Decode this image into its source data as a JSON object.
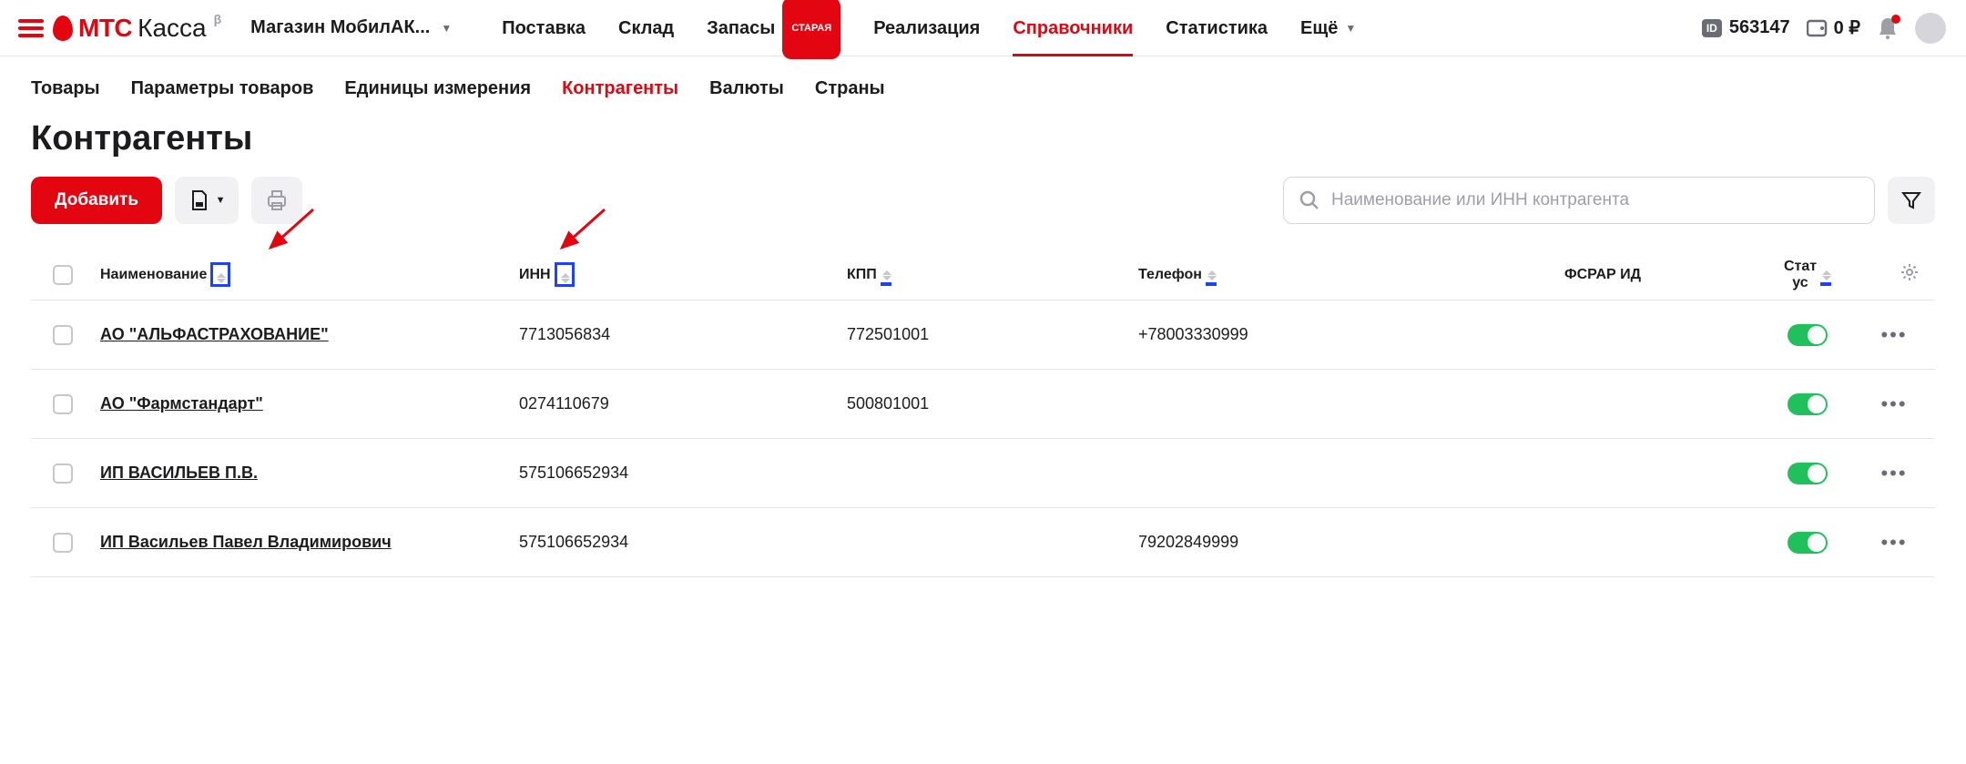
{
  "header": {
    "logo_mts": "МТС",
    "logo_kassa": "Касса",
    "beta": "β",
    "store_name": "Магазин МобилАК...",
    "nav": [
      "Поставка",
      "Склад",
      "Запасы",
      "Реализация",
      "Справочники",
      "Статистика",
      "Ещё"
    ],
    "badge_old": "СТАРАЯ",
    "active_nav": "Справочники",
    "id": "563147",
    "wallet": "0 ₽"
  },
  "sub_tabs": {
    "items": [
      "Товары",
      "Параметры товаров",
      "Единицы измерения",
      "Контрагенты",
      "Валюты",
      "Страны"
    ],
    "active": "Контрагенты"
  },
  "page": {
    "title": "Контрагенты",
    "add_label": "Добавить",
    "search_placeholder": "Наименование или ИНН контрагента"
  },
  "table": {
    "headers": {
      "name": "Наименование",
      "inn": "ИНН",
      "kpp": "КПП",
      "phone": "Телефон",
      "fsrar": "ФСРАР ИД",
      "status": "Стат\nус"
    },
    "rows": [
      {
        "name": "АО \"АЛЬФАСТРАХОВАНИЕ\"",
        "inn": "7713056834",
        "kpp": "772501001",
        "phone": "+78003330999",
        "fsrar": "",
        "active": true
      },
      {
        "name": "АО \"Фармстандарт\"",
        "inn": "0274110679",
        "kpp": "500801001",
        "phone": "",
        "fsrar": "",
        "active": true
      },
      {
        "name": "ИП ВАСИЛЬЕВ П.В.",
        "inn": "575106652934",
        "kpp": "",
        "phone": "",
        "fsrar": "",
        "active": true
      },
      {
        "name": "ИП Васильев Павел Владимирович",
        "inn": "575106652934",
        "kpp": "",
        "phone": "79202849999",
        "fsrar": "",
        "active": true
      }
    ]
  }
}
